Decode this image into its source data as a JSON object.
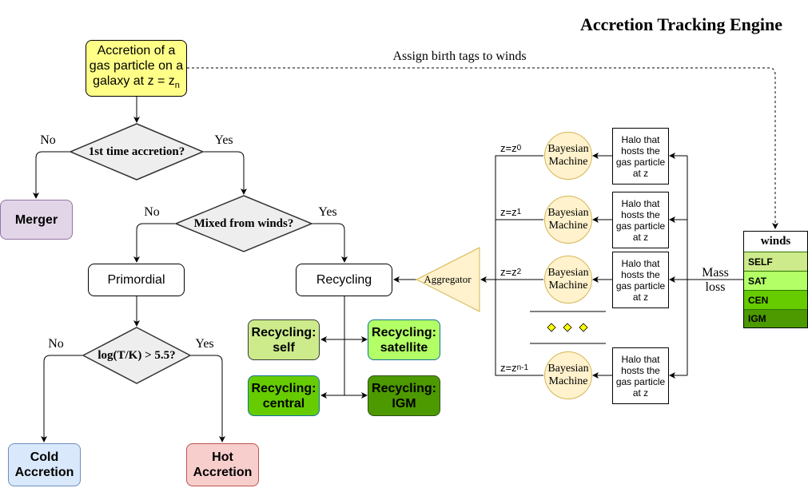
{
  "title": "Accretion Tracking Engine",
  "start_node": {
    "line1": "Accretion of a",
    "line2": "gas particle on a",
    "line3": "galaxy at z = z",
    "sub": "n"
  },
  "assign_label": "Assign birth tags to winds",
  "decisions": {
    "first_time": "1st time accretion?",
    "mixed_winds": "Mixed from winds?",
    "temperature": "log(T/K) > 5.5?"
  },
  "branch_labels": {
    "no": "No",
    "yes": "Yes"
  },
  "nodes": {
    "merger": "Merger",
    "primordial": "Primordial",
    "recycling": "Recycling",
    "cold": {
      "line1": "Cold",
      "line2": "Accretion"
    },
    "hot": {
      "line1": "Hot",
      "line2": "Accretion"
    }
  },
  "recycling_types": [
    {
      "line1": "Recycling:",
      "line2": "self",
      "color": "#cdeb8b"
    },
    {
      "line1": "Recycling:",
      "line2": "satellite",
      "color": "#b3ff66"
    },
    {
      "line1": "Recycling:",
      "line2": "central",
      "color": "#66cc00"
    },
    {
      "line1": "Recycling:",
      "line2": "IGM",
      "color": "#4d9900"
    }
  ],
  "aggregator": "Aggregator",
  "bayesian": {
    "line1": "Bayesian",
    "line2": "Machine"
  },
  "halo": {
    "line1": "Halo that",
    "line2": "hosts the",
    "line3": "gas particle",
    "line4": "at z"
  },
  "redshifts": [
    {
      "base": "z=z",
      "sub": "0"
    },
    {
      "base": "z=z",
      "sub": "1"
    },
    {
      "base": "z=z",
      "sub": "2"
    },
    {
      "base": "z=z",
      "sub": "n-1"
    }
  ],
  "mass_loss": {
    "line1": "Mass",
    "line2": "loss"
  },
  "winds": {
    "header": "winds",
    "rows": [
      {
        "label": "SELF",
        "color": "#cdeb8b"
      },
      {
        "label": "SAT",
        "color": "#b3ff66"
      },
      {
        "label": "CEN",
        "color": "#66cc00"
      },
      {
        "label": "IGM",
        "color": "#4d9900"
      }
    ]
  },
  "colors": {
    "start": "#ffff88",
    "decision": "#eeeeee",
    "merger": "#e1d5e7",
    "cold": "#dae8fc",
    "hot": "#f8cecc",
    "bayesian": "#fff2cc",
    "ellipsis_diamond": "#ffff00"
  }
}
